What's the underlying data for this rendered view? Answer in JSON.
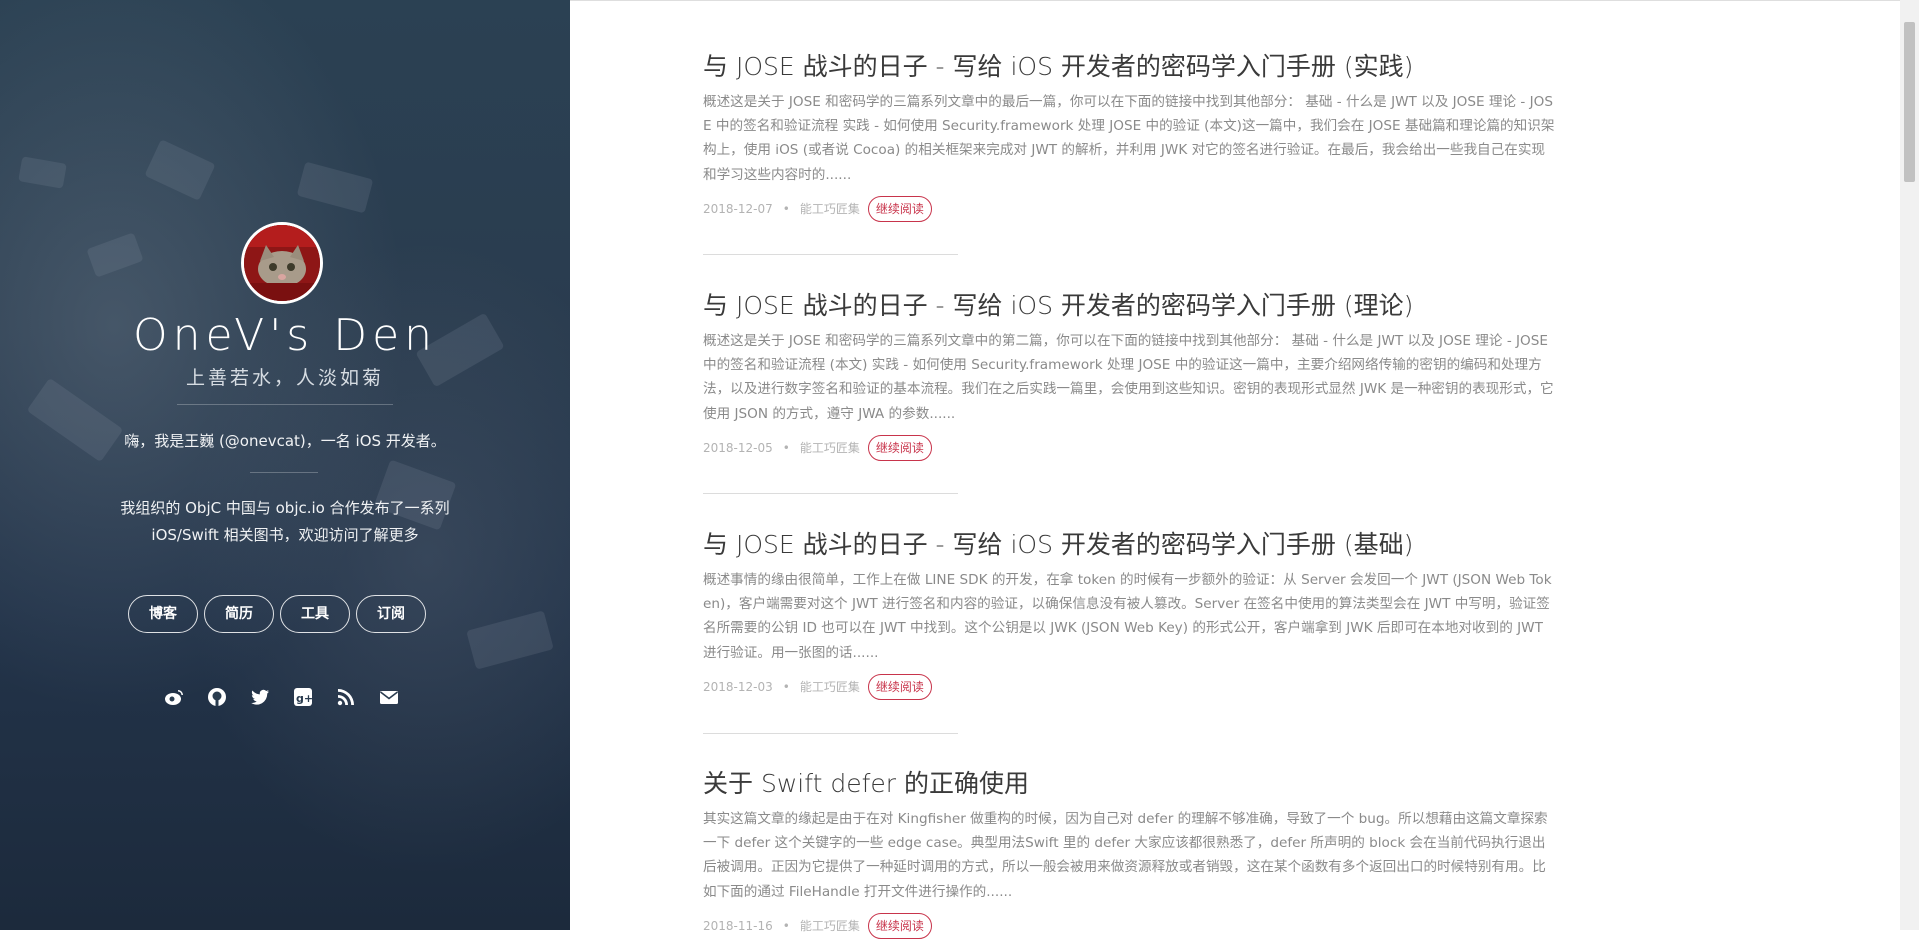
{
  "sidebar": {
    "title": "OneV's Den",
    "motto": "上善若水，人淡如菊",
    "intro": "嗨，我是王巍 (@onevcat)，一名 iOS 开发者。",
    "books_line1": "我组织的 ObjC 中国与 objc.io 合作发布了一系列",
    "books_line2": "iOS/Swift 相关图书，欢迎访问了解更多",
    "nav": [
      {
        "label": "博客"
      },
      {
        "label": "简历"
      },
      {
        "label": "工具"
      },
      {
        "label": "订阅"
      }
    ],
    "social": [
      "weibo-icon",
      "github-icon",
      "twitter-icon",
      "google-plus-icon",
      "rss-icon",
      "email-icon"
    ]
  },
  "posts": [
    {
      "title": "与 JOSE 战斗的日子 - 写给 iOS 开发者的密码学入门手册 (实践)",
      "excerpt": "概述这是关于 JOSE 和密码学的三篇系列文章中的最后一篇，你可以在下面的链接中找到其他部分： 基础 - 什么是 JWT 以及 JOSE 理论 - JOSE 中的签名和验证流程 实践 - 如何使用 Security.framework 处理 JOSE 中的验证 (本文)这一篇中，我们会在 JOSE 基础篇和理论篇的知识架构上，使用 iOS (或者说 Cocoa) 的相关框架来完成对 JWT 的解析，并利用 JWK 对它的签名进行验证。在最后，我会给出一些我自己在实现和学习这些内容时的......",
      "date": "2018-12-07",
      "category": "能工巧匠集",
      "read_more": "继续阅读"
    },
    {
      "title": "与 JOSE 战斗的日子 - 写给 iOS 开发者的密码学入门手册 (理论)",
      "excerpt": "概述这是关于 JOSE 和密码学的三篇系列文章中的第二篇，你可以在下面的链接中找到其他部分： 基础 - 什么是 JWT 以及 JOSE 理论 - JOSE 中的签名和验证流程 (本文) 实践 - 如何使用 Security.framework 处理 JOSE 中的验证这一篇中，主要介绍网络传输的密钥的编码和处理方法，以及进行数字签名和验证的基本流程。我们在之后实践一篇里，会使用到这些知识。密钥的表现形式显然 JWK 是一种密钥的表现形式，它使用 JSON 的方式，遵守 JWA 的参数......",
      "date": "2018-12-05",
      "category": "能工巧匠集",
      "read_more": "继续阅读"
    },
    {
      "title": "与 JOSE 战斗的日子 - 写给 iOS 开发者的密码学入门手册 (基础)",
      "excerpt": "概述事情的缘由很简单，工作上在做 LINE SDK 的开发，在拿 token 的时候有一步额外的验证：从 Server 会发回一个 JWT (JSON Web Token)，客户端需要对这个 JWT 进行签名和内容的验证，以确保信息没有被人篡改。Server 在签名中使用的算法类型会在 JWT 中写明，验证签名所需要的公钥 ID 也可以在 JWT 中找到。这个公钥是以 JWK (JSON Web Key) 的形式公开，客户端拿到 JWK 后即可在本地对收到的 JWT 进行验证。用一张图的话......",
      "date": "2018-12-03",
      "category": "能工巧匠集",
      "read_more": "继续阅读"
    },
    {
      "title": "关于 Swift defer 的正确使用",
      "excerpt": "其实这篇文章的缘起是由于在对 Kingfisher 做重构的时候，因为自己对 defer 的理解不够准确，导致了一个 bug。所以想藉由这篇文章探索一下 defer 这个关键字的一些 edge case。典型用法Swift 里的 defer 大家应该都很熟悉了，defer 所声明的 block 会在当前代码执行退出后被调用。正因为它提供了一种延时调用的方式，所以一般会被用来做资源释放或者销毁，这在某个函数有多个返回出口的时候特别有用。比如下面的通过 FileHandle 打开文件进行操作的......",
      "date": "2018-11-16",
      "category": "能工巧匠集",
      "read_more": "继续阅读"
    }
  ]
}
